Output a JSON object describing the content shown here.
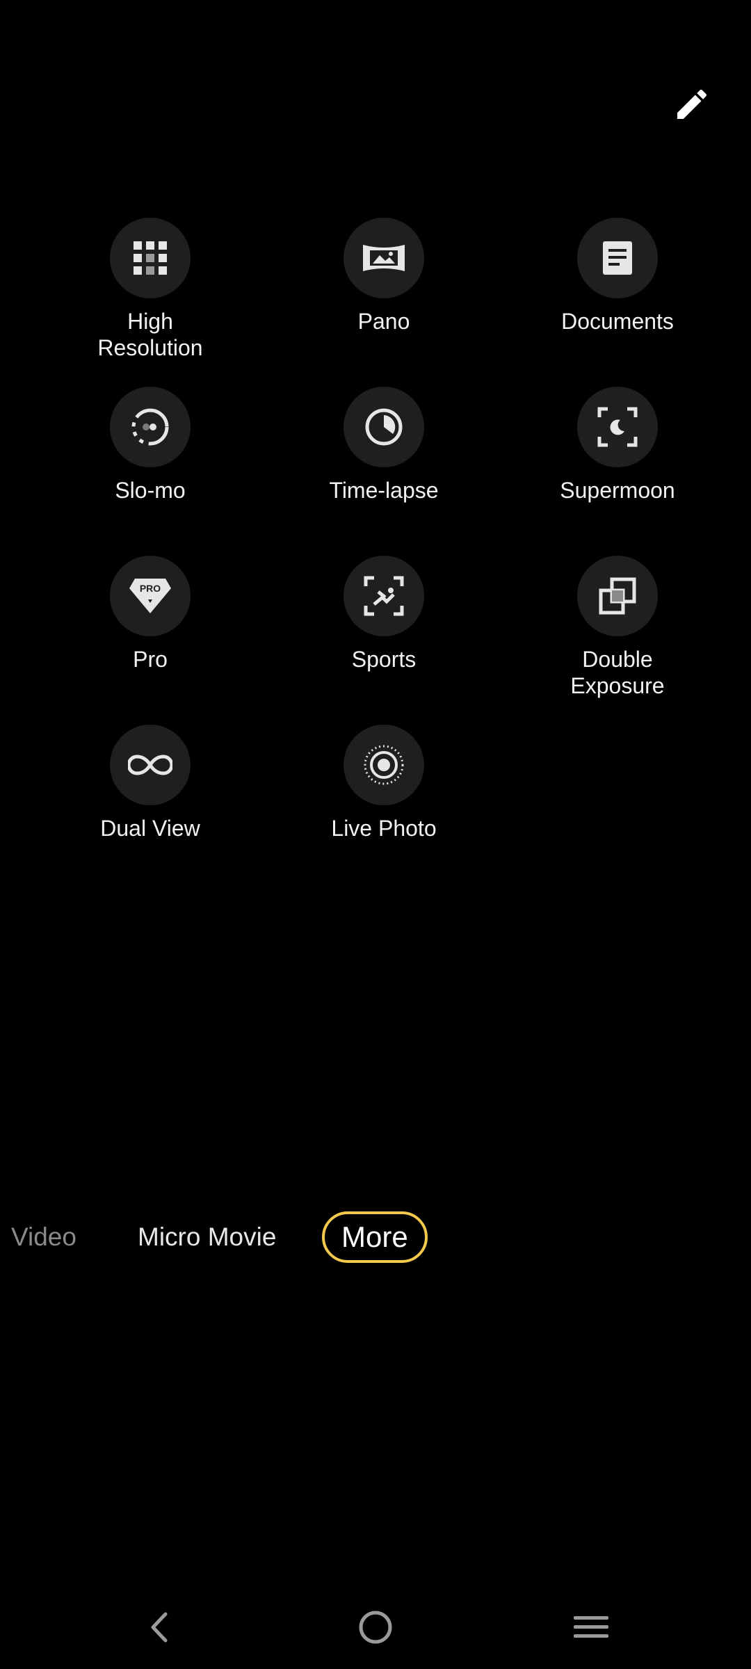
{
  "toolbar": {
    "edit_icon": "pencil-icon"
  },
  "modes": [
    {
      "label": "High\nResolution",
      "icon": "grid-icon"
    },
    {
      "label": "Pano",
      "icon": "panorama-icon"
    },
    {
      "label": "Documents",
      "icon": "document-icon"
    },
    {
      "label": "Slo-mo",
      "icon": "slowmo-icon"
    },
    {
      "label": "Time-lapse",
      "icon": "clock-icon"
    },
    {
      "label": "Supermoon",
      "icon": "moon-focus-icon"
    },
    {
      "label": "Pro",
      "icon": "pro-diamond-icon"
    },
    {
      "label": "Sports",
      "icon": "sports-focus-icon"
    },
    {
      "label": "Double\nExposure",
      "icon": "double-exposure-icon"
    },
    {
      "label": "Dual View",
      "icon": "infinity-icon"
    },
    {
      "label": "Live Photo",
      "icon": "live-photo-icon"
    }
  ],
  "mode_bar": {
    "tabs": [
      {
        "label": "Video"
      },
      {
        "label": "Micro Movie"
      },
      {
        "label": "More"
      }
    ],
    "active": "More",
    "active_color": "#f2c94c"
  },
  "nav": {
    "back_icon": "back-chevron-icon",
    "home_icon": "home-circle-icon",
    "menu_icon": "menu-icon"
  }
}
